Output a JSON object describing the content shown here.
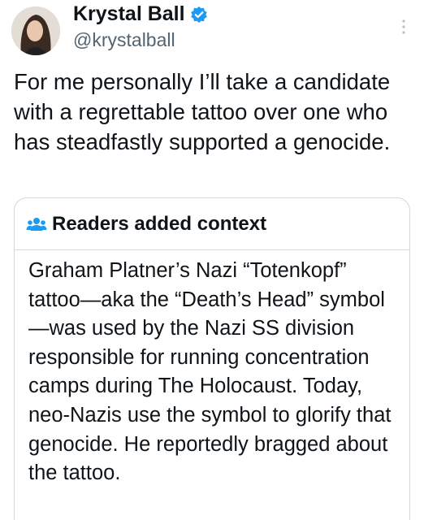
{
  "author": {
    "display_name": "Krystal Ball",
    "handle": "@krystalball",
    "verified_icon": "verified-badge-icon",
    "avatar_icon": "avatar"
  },
  "tweet": {
    "text": "For me personally I’ll take a candidate with a regrettable tattoo over one who has steadfastly supported a genocide."
  },
  "context": {
    "icon": "people-icon",
    "title": "Readers added context",
    "body": "Graham Platner’s Nazi “Totenkopf” tattoo—aka the “Death’s Head” symbol—was used by the Nazi SS division responsible for running concentration camps during The Holocaust. Today, neo-Nazis use the symbol to glorify that genocide. He reportedly bragged about the tattoo."
  },
  "colors": {
    "text": "#0f1419",
    "secondary": "#536471",
    "verified": "#1d9bf0",
    "border": "#cfd9de"
  }
}
